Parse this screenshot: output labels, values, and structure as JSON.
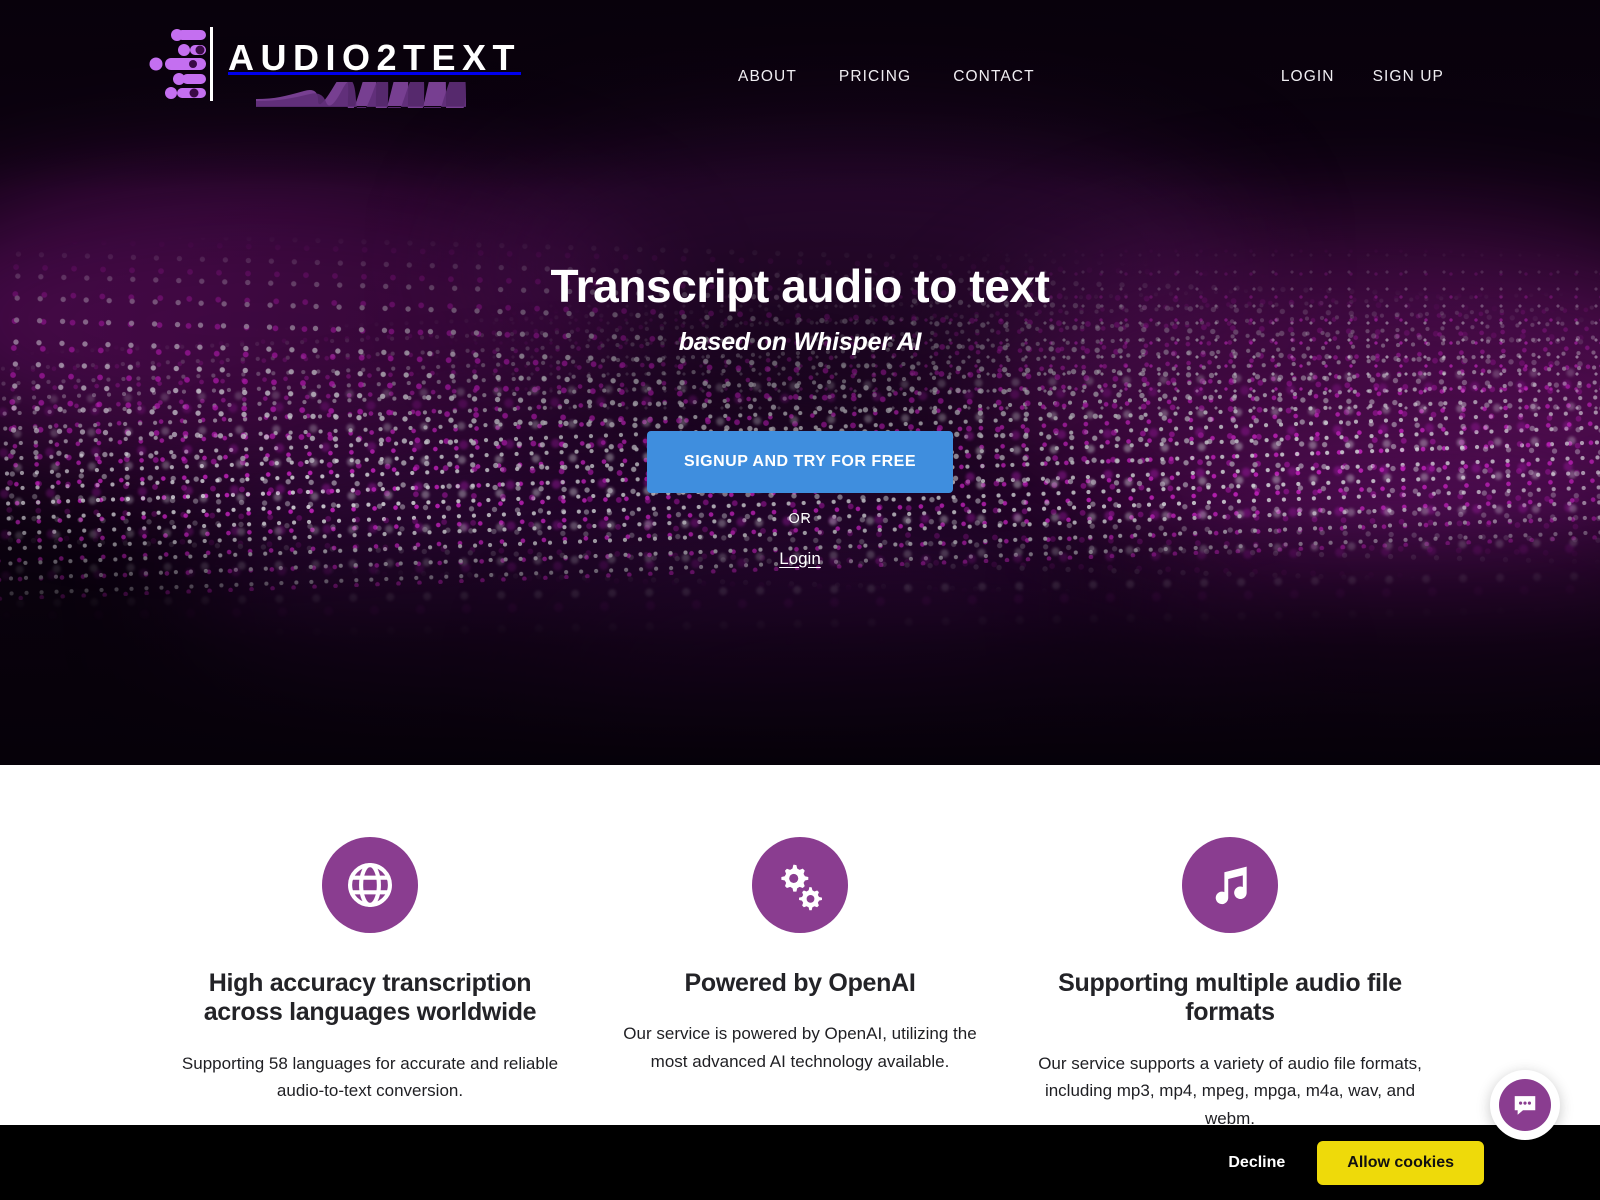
{
  "brand": {
    "name": "AUDIO2TEXT",
    "logo_icon": "audio-equalizer-icon",
    "logo_wave_icon": "soundwave-icon"
  },
  "header": {
    "nav": [
      {
        "label": "ABOUT",
        "name": "nav-about"
      },
      {
        "label": "PRICING",
        "name": "nav-pricing"
      },
      {
        "label": "CONTACT",
        "name": "nav-contact"
      }
    ],
    "auth": [
      {
        "label": "LOGIN",
        "name": "nav-login"
      },
      {
        "label": "SIGN UP",
        "name": "nav-signup"
      }
    ]
  },
  "hero": {
    "title": "Transcript audio to text",
    "subtitle": "based on Whisper AI",
    "cta_label": "SIGNUP AND TRY FOR FREE",
    "or_label": "OR",
    "login_label": "Login",
    "background_colors": {
      "base": "#0c0210",
      "particle_magenta": "#d826d0",
      "particle_white": "#e4e4e8"
    },
    "cta_color": "#3f8ede"
  },
  "features": {
    "accent_color": "#8a3d90",
    "items": [
      {
        "icon": "globe-icon",
        "title": "High accuracy transcription across languages worldwide",
        "description": "Supporting 58 languages for accurate and reliable audio-to-text conversion."
      },
      {
        "icon": "gears-icon",
        "title": "Powered by OpenAI",
        "description": "Our service is powered by OpenAI, utilizing the most advanced AI technology available."
      },
      {
        "icon": "music-note-icon",
        "title": "Supporting multiple audio file formats",
        "description": "Our service supports a variety of audio file formats, including mp3, mp4, mpeg, mpga, m4a, wav, and webm."
      }
    ]
  },
  "cookie_banner": {
    "decline_label": "Decline",
    "allow_label": "Allow cookies",
    "allow_color": "#eeda0a",
    "background": "#000000"
  },
  "chat_widget": {
    "icon": "chat-bubble-icon",
    "color": "#8a3d90"
  }
}
